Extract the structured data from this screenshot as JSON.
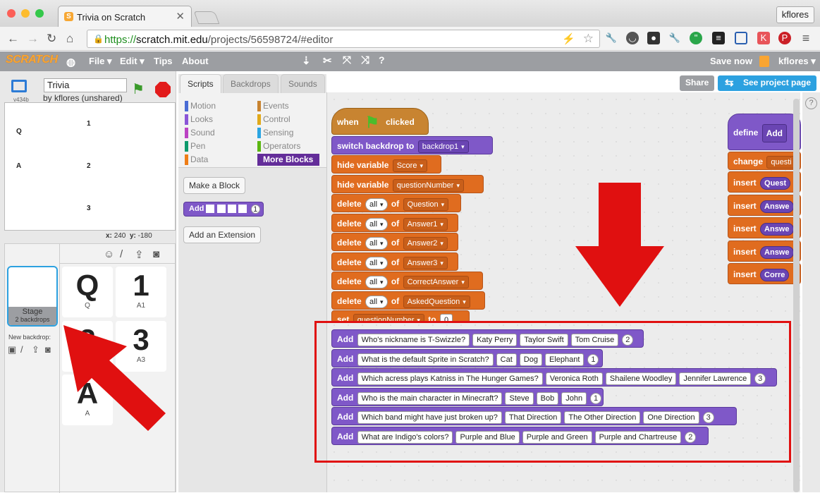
{
  "browser": {
    "tab_title": "Trivia on Scratch",
    "url_prefix": "https://",
    "url_host": "scratch.mit.edu",
    "url_path": "/projects/56598724/#editor",
    "user": "kflores"
  },
  "menu": {
    "logo": "SCRATCH",
    "file": "File ▾",
    "edit": "Edit ▾",
    "tips": "Tips",
    "about": "About",
    "save_now": "Save now",
    "user": "kflores ▾"
  },
  "project": {
    "title": "Trivia",
    "by": "by kflores (unshared)",
    "version": "v434b",
    "x_label": "x:",
    "x_value": "240",
    "y_label": "y:",
    "y_value": "-180"
  },
  "stage_text": {
    "q": "Q",
    "a": "A",
    "n1": "1",
    "n2": "2",
    "n3": "3"
  },
  "sprites": {
    "stage_label": "Stage",
    "stage_sub": "2 backdrops",
    "new_backdrop": "New backdrop:",
    "costumes": [
      {
        "glyph": "Q",
        "label": "Q"
      },
      {
        "glyph": "1",
        "label": "A1"
      },
      {
        "glyph": "2",
        "label": ""
      },
      {
        "glyph": "3",
        "label": "A3"
      },
      {
        "glyph": "A",
        "label": "A"
      }
    ]
  },
  "palette": {
    "tabs": [
      "Scripts",
      "Backdrops",
      "Sounds"
    ],
    "categories_left": [
      {
        "label": "Motion",
        "color": "#4a6cd4"
      },
      {
        "label": "Looks",
        "color": "#8a55d7"
      },
      {
        "label": "Sound",
        "color": "#bb42c3"
      },
      {
        "label": "Pen",
        "color": "#0e9a6c"
      },
      {
        "label": "Data",
        "color": "#ee7d16"
      }
    ],
    "categories_right": [
      {
        "label": "Events",
        "color": "#c88330"
      },
      {
        "label": "Control",
        "color": "#e1a91a"
      },
      {
        "label": "Sensing",
        "color": "#2ca5e2"
      },
      {
        "label": "Operators",
        "color": "#5cb712"
      },
      {
        "label": "More Blocks",
        "color": "#632d99"
      }
    ],
    "make_block": "Make a Block",
    "add_block": "Add",
    "add_block_num": "1",
    "add_extension": "Add an Extension"
  },
  "header": {
    "share": "Share",
    "see_project": "See project page"
  },
  "script": {
    "hat_when": "when",
    "hat_clicked": "clicked",
    "switch_backdrop": "switch backdrop",
    "to": "to",
    "backdrop1": "backdrop1",
    "hide_variable": "hide variable",
    "score": "Score",
    "question_number": "questionNumber",
    "delete": "delete",
    "all": "all",
    "of": "of",
    "lists": [
      "Question",
      "Answer1",
      "Answer2",
      "Answer3",
      "CorrectAnswer",
      "AskedQuestion"
    ],
    "set": "set",
    "set_var": "questionNumber",
    "set_val": "0",
    "add_rows": [
      {
        "q": "Who's nickname is T-Swizzle?",
        "a1": "Katy Perry",
        "a2": "Taylor Swift",
        "a3": "Tom Cruise",
        "n": "2"
      },
      {
        "q": "What is the default Sprite in Scratch?",
        "a1": "Cat",
        "a2": "Dog",
        "a3": "Elephant",
        "n": "1"
      },
      {
        "q": "Which acress plays Katniss in The Hunger Games?",
        "a1": "Veronica Roth",
        "a2": "Shailene Woodley",
        "a3": "Jennifer Lawrence",
        "n": "3"
      },
      {
        "q": "Who is the main character in Minecraft?",
        "a1": "Steve",
        "a2": "Bob",
        "a3": "John",
        "n": "1"
      },
      {
        "q": "Which band might have just broken up?",
        "a1": "That Direction",
        "a2": "The Other Direction",
        "a3": "One Direction",
        "n": "3"
      },
      {
        "q": "What are Indigo's colors?",
        "a1": "Purple and Blue",
        "a2": "Purple and Green",
        "a3": "Purple and Chartreuse",
        "n": "2"
      }
    ]
  },
  "define_script": {
    "define": "define",
    "add": "Add",
    "change": "change",
    "change_field": "questi",
    "insert": "insert",
    "inserts": [
      "Quest",
      "Answe",
      "Answe",
      "Answe",
      "Corre"
    ]
  },
  "colors": {
    "accent_blue": "#2ca1e0",
    "annotation_red": "#e01010",
    "more_blocks": "#7f58c8",
    "data_orange": "#e06c1f"
  }
}
